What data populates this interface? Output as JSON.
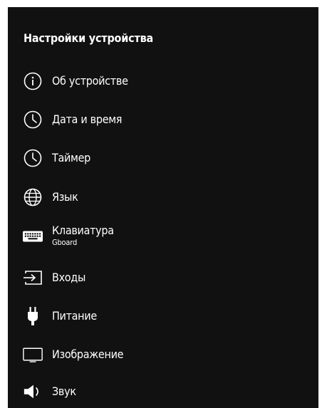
{
  "header": {
    "title": "Настройки устройства"
  },
  "menu": {
    "items": [
      {
        "icon": "info-icon",
        "label": "Об устройстве"
      },
      {
        "icon": "clock-icon",
        "label": "Дата и время"
      },
      {
        "icon": "clock-icon",
        "label": "Таймер"
      },
      {
        "icon": "globe-icon",
        "label": "Язык"
      },
      {
        "icon": "keyboard-icon",
        "label": "Клавиатура",
        "sublabel": "Gboard"
      },
      {
        "icon": "input-icon",
        "label": "Входы"
      },
      {
        "icon": "power-plug-icon",
        "label": "Питание"
      },
      {
        "icon": "display-icon",
        "label": "Изображение"
      },
      {
        "icon": "speaker-icon",
        "label": "Звук"
      }
    ]
  },
  "colors": {
    "background": "#111111",
    "text": "#ffffff",
    "frame": "#ffffff"
  }
}
